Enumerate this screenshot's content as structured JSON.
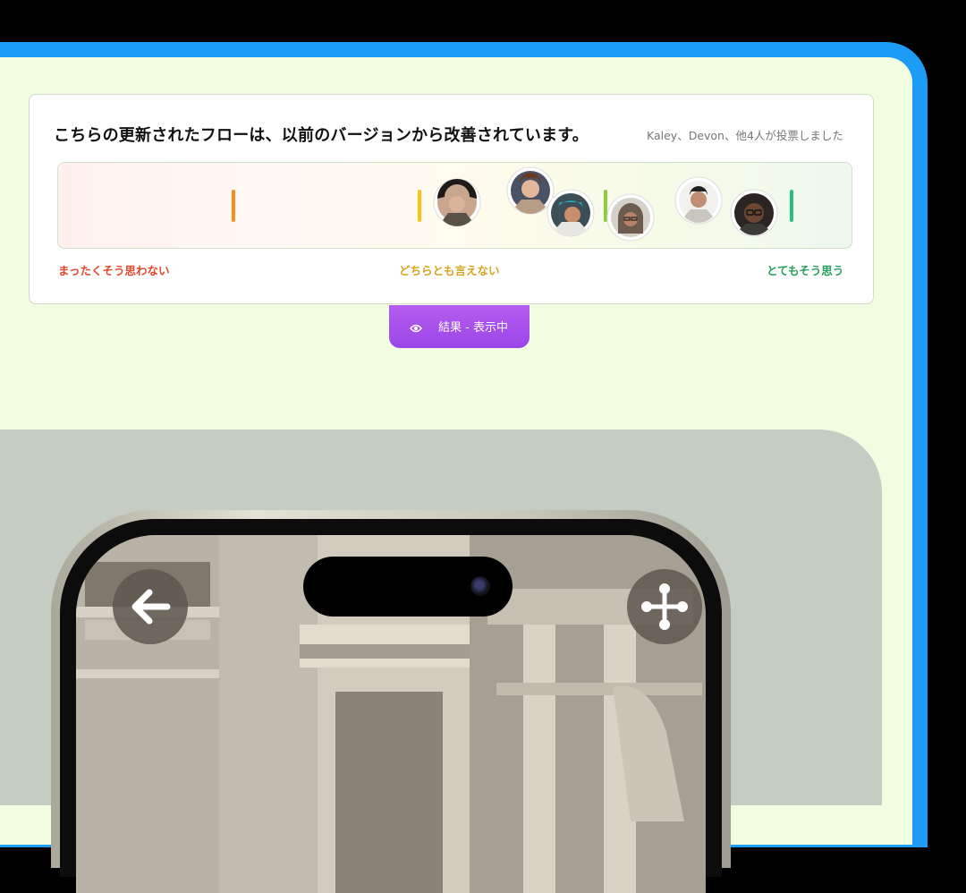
{
  "poll": {
    "question": "こちらの更新されたフローは、以前のバージョンから改善されています。",
    "voters_note": "Kaley、Devon、他4人が投票しました",
    "scale_labels": {
      "left": "まったくそう思わない",
      "middle": "どちらとも言えない",
      "right": "とてもそう思う"
    },
    "results_tab": {
      "label": "結果 - 表示中",
      "icon": "eye-icon"
    },
    "colors": {
      "red": "#e8462a",
      "orange": "#f4901c",
      "yellow": "#f5c712",
      "green": "#6cc845",
      "teal": "#27c07a",
      "tab": "#a24ee9"
    }
  },
  "device": {
    "back_icon": "arrow-left-icon",
    "move_icon": "move-arrows-icon"
  }
}
